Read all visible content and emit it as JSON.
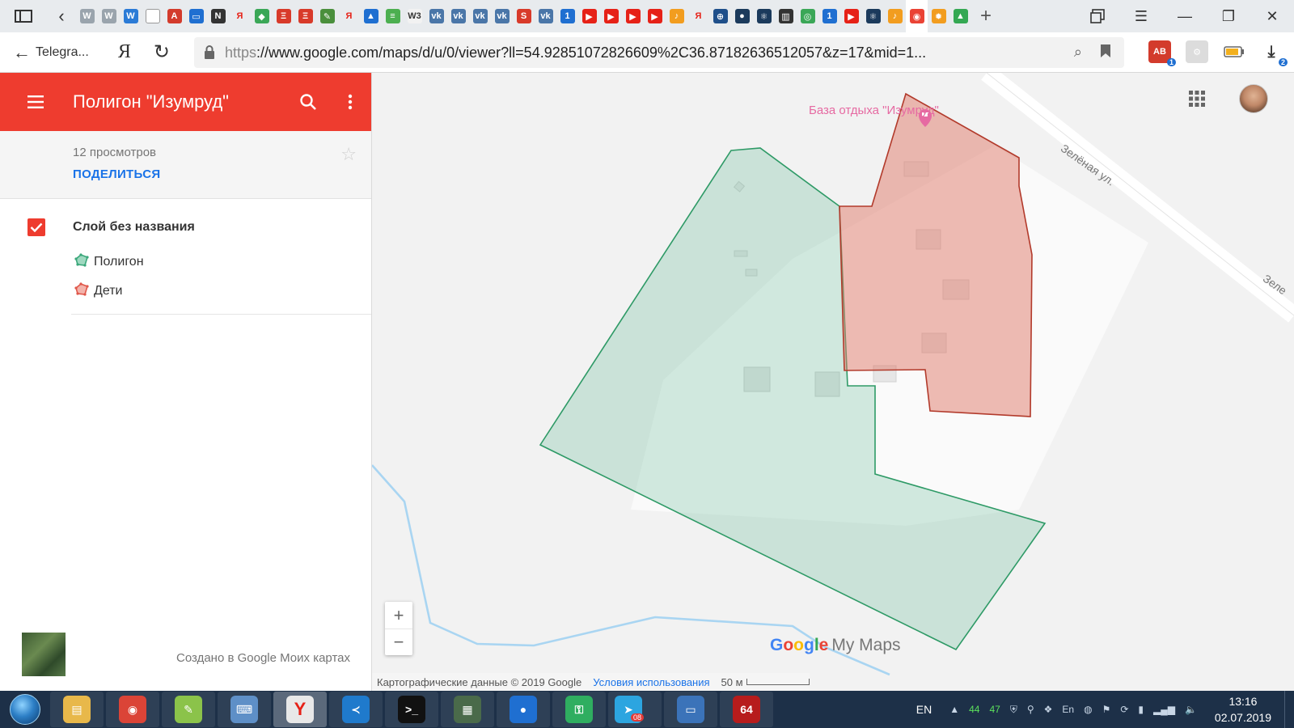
{
  "browser": {
    "back_label": "Telegra...",
    "yandex_label": "Я",
    "url_protocol": "https",
    "url_rest": "://www.google.com/maps/d/u/0/viewer?ll=54.92851072826609%2C36.87182636512057&z=17&mid=1...",
    "tabs": [
      {
        "icon": "W",
        "color": "#9aa4ad",
        "name": "doc-icon"
      },
      {
        "icon": "W",
        "color": "#9aa4ad",
        "name": "doc-icon"
      },
      {
        "icon": "W",
        "color": "#2b7bd6",
        "name": "wp-icon"
      },
      {
        "icon": "",
        "color": "#ffffff",
        "name": "page-icon"
      },
      {
        "icon": "A",
        "color": "#d33b2c",
        "name": "abp-icon"
      },
      {
        "icon": "▭",
        "color": "#1f6fd1",
        "name": "chat-icon"
      },
      {
        "icon": "N",
        "color": "#333333",
        "name": "nums-icon"
      },
      {
        "icon": "Я",
        "color": "#e8ebee",
        "name": "yandex-icon"
      },
      {
        "icon": "◆",
        "color": "#3aa757",
        "name": "maps-icon"
      },
      {
        "icon": "Ξ",
        "color": "#d83a2a",
        "name": "list-icon"
      },
      {
        "icon": "Ξ",
        "color": "#d83a2a",
        "name": "list-icon"
      },
      {
        "icon": "✎",
        "color": "#4a8f3c",
        "name": "tool-icon"
      },
      {
        "icon": "Я",
        "color": "#e8ebee",
        "name": "yandex-icon"
      },
      {
        "icon": "▲",
        "color": "#1f6fd1",
        "name": "bird-icon"
      },
      {
        "icon": "≡",
        "color": "#4caf50",
        "name": "sheet-icon"
      },
      {
        "icon": "W3",
        "color": "#f2f2f2",
        "name": "w3-icon"
      },
      {
        "icon": "vk",
        "color": "#4a76a8",
        "name": "vk-icon"
      },
      {
        "icon": "vk",
        "color": "#4a76a8",
        "name": "vk-icon"
      },
      {
        "icon": "vk",
        "color": "#4a76a8",
        "name": "vk-icon"
      },
      {
        "icon": "vk",
        "color": "#4a76a8",
        "name": "vk-icon"
      },
      {
        "icon": "S",
        "color": "#d83a2a",
        "name": "sberbank-icon"
      },
      {
        "icon": "vk",
        "color": "#4a76a8",
        "name": "vk-icon"
      },
      {
        "icon": "1",
        "color": "#1f6fd1",
        "name": "one-icon"
      },
      {
        "icon": "▶",
        "color": "#e62117",
        "name": "youtube-icon"
      },
      {
        "icon": "▶",
        "color": "#e62117",
        "name": "youtube-icon"
      },
      {
        "icon": "▶",
        "color": "#e62117",
        "name": "youtube-icon"
      },
      {
        "icon": "▶",
        "color": "#e62117",
        "name": "youtube-icon"
      },
      {
        "icon": "♪",
        "color": "#f29d1f",
        "name": "music-icon"
      },
      {
        "icon": "Я",
        "color": "#e8ebee",
        "name": "yandex-icon"
      },
      {
        "icon": "⊕",
        "color": "#1f4f8a",
        "name": "team-icon"
      },
      {
        "icon": "●",
        "color": "#1b3a5c",
        "name": "cloud-icon"
      },
      {
        "icon": "⚛",
        "color": "#1b3a5c",
        "name": "react-icon"
      },
      {
        "icon": "▥",
        "color": "#333333",
        "name": "chart-icon"
      },
      {
        "icon": "◎",
        "color": "#3aa757",
        "name": "globe-icon"
      },
      {
        "icon": "1",
        "color": "#1f6fd1",
        "name": "one-icon"
      },
      {
        "icon": "▶",
        "color": "#e62117",
        "name": "youtube-icon"
      },
      {
        "icon": "⚛",
        "color": "#1b3a5c",
        "name": "react-icon"
      },
      {
        "icon": "♪",
        "color": "#f29d1f",
        "name": "music-icon"
      },
      {
        "icon": "◉",
        "color": "#ea4335",
        "name": "mymaps-icon",
        "active": true
      },
      {
        "icon": "✹",
        "color": "#f29d1f",
        "name": "sun-icon"
      },
      {
        "icon": "▲",
        "color": "#34a853",
        "name": "drive-icon"
      }
    ],
    "ext_badge": "1",
    "download_badge": "2",
    "ext_label": "AB"
  },
  "panel": {
    "title": "Полигон \"Изумруд\"",
    "views": "12 просмотров",
    "share": "ПОДЕЛИТЬСЯ",
    "layer_name": "Слой без названия",
    "features": [
      {
        "label": "Полигон",
        "color": "#3aa77a"
      },
      {
        "label": "Дети",
        "color": "#e0574a"
      }
    ],
    "credit": "Создано в Google Моих картах"
  },
  "map": {
    "poi_label": "База отдыха \"Изумруд\"",
    "street_label": "Зелёная ул.",
    "street_label_2": "Зеле",
    "brand_google": "Google",
    "brand_mymaps": "My Maps",
    "attribution": "Картографические данные © 2019 Google",
    "terms": "Условия использования",
    "scale": "50 м",
    "zoom_in": "+",
    "zoom_out": "−",
    "polygon_green_color": "#3aa77a",
    "polygon_red_color": "#c0392b"
  },
  "taskbar": {
    "apps": [
      {
        "name": "explorer-icon",
        "color": "#e8b84a",
        "label": "▤"
      },
      {
        "name": "chrome-icon",
        "color": "#db4437",
        "label": "◉"
      },
      {
        "name": "notes-icon",
        "color": "#8bc34a",
        "label": "✎"
      },
      {
        "name": "keyboard-icon",
        "color": "#5e8fc7",
        "label": "⌨"
      },
      {
        "name": "yandex-browser-icon",
        "color": "#e8e8e8",
        "label": "Y",
        "active": true
      },
      {
        "name": "vscode-icon",
        "color": "#1f7acc",
        "label": "≺"
      },
      {
        "name": "cmd-icon",
        "color": "#111111",
        "label": ">_"
      },
      {
        "name": "monitor-icon",
        "color": "#4a6a4a",
        "label": "▦"
      },
      {
        "name": "location-icon",
        "color": "#1f6fd1",
        "label": "●"
      },
      {
        "name": "vpn-icon",
        "color": "#2fae60",
        "label": "⚿"
      },
      {
        "name": "telegram-icon",
        "color": "#2ca5e0",
        "label": "➤",
        "badge": "08"
      },
      {
        "name": "remote-desktop-icon",
        "color": "#3b73b9",
        "label": "▭"
      },
      {
        "name": "bug-icon",
        "color": "#b71c1c",
        "label": "64"
      }
    ],
    "lang": "EN",
    "tray_numbers": [
      "44",
      "47"
    ],
    "tray_input": "En",
    "time": "13:16",
    "date": "02.07.2019"
  }
}
